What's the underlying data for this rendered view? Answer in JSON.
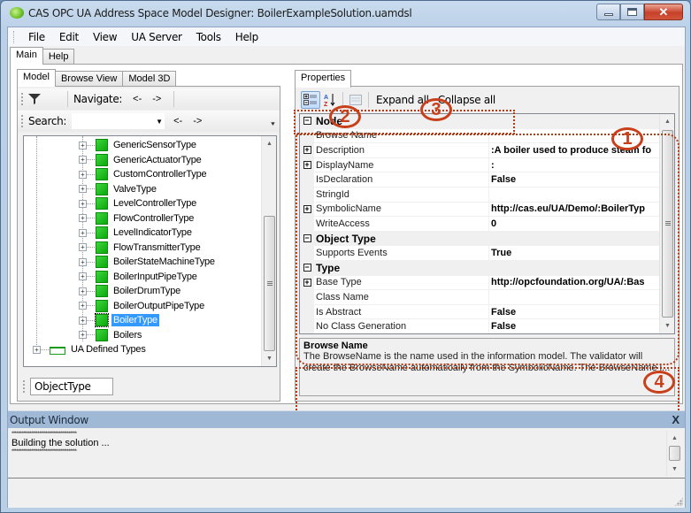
{
  "window": {
    "title": "CAS OPC UA Address Space Model Designer: BoilerExampleSolution.uamdsl",
    "icon": "app-logo-icon",
    "controls": {
      "minimize": "minimize-icon",
      "maximize": "maximize-icon",
      "close": "close-icon",
      "close_glyph": "✕"
    }
  },
  "menu": [
    "File",
    "Edit",
    "View",
    "UA Server",
    "Tools",
    "Help"
  ],
  "main_tabs": [
    {
      "label": "Main",
      "active": true
    },
    {
      "label": "Help",
      "active": false
    }
  ],
  "left_panel": {
    "tabs": [
      {
        "label": "Model",
        "active": true
      },
      {
        "label": "Browse View",
        "active": false
      },
      {
        "label": "Model 3D",
        "active": false
      }
    ],
    "toolbar": {
      "filter_icon": "filter-icon",
      "navigate_label": "Navigate:",
      "back": "<-",
      "forward": "->"
    },
    "search": {
      "label": "Search:",
      "value": "",
      "back": "<-",
      "forward": "->"
    },
    "tree": {
      "items": [
        {
          "label": "GenericSensorType",
          "level": 2,
          "selected": false
        },
        {
          "label": "GenericActuatorType",
          "level": 2,
          "selected": false
        },
        {
          "label": "CustomControllerType",
          "level": 2,
          "selected": false
        },
        {
          "label": "ValveType",
          "level": 2,
          "selected": false
        },
        {
          "label": "LevelControllerType",
          "level": 2,
          "selected": false
        },
        {
          "label": "FlowControllerType",
          "level": 2,
          "selected": false
        },
        {
          "label": "LevelIndicatorType",
          "level": 2,
          "selected": false
        },
        {
          "label": "FlowTransmitterType",
          "level": 2,
          "selected": false
        },
        {
          "label": "BoilerStateMachineType",
          "level": 2,
          "selected": false
        },
        {
          "label": "BoilerInputPipeType",
          "level": 2,
          "selected": false
        },
        {
          "label": "BoilerDrumType",
          "level": 2,
          "selected": false
        },
        {
          "label": "BoilerOutputPipeType",
          "level": 2,
          "selected": false
        },
        {
          "label": "BoilerType",
          "level": 2,
          "selected": true
        },
        {
          "label": "Boilers",
          "level": 2,
          "selected": false
        },
        {
          "label": "UA Defined Types",
          "level": 0,
          "selected": false
        }
      ]
    },
    "status_value": "ObjectType"
  },
  "properties": {
    "tab_label": "Properties",
    "toolbar": {
      "categorized": "categorized-view-icon",
      "alphabetical": "sort-az-icon",
      "pages": "property-pages-icon",
      "expand_all": "Expand all",
      "collapse_all": "Collapse all"
    },
    "rows": [
      {
        "type": "category",
        "name": "Node",
        "expanded": true
      },
      {
        "type": "prop",
        "name": "Browse Name",
        "value": "",
        "expandable": false
      },
      {
        "type": "prop",
        "name": "Description",
        "value": ":A boiler used to produce steam fo",
        "expandable": true
      },
      {
        "type": "prop",
        "name": "DisplayName",
        "value": ":",
        "expandable": true
      },
      {
        "type": "prop",
        "name": "IsDeclaration",
        "value": "False",
        "expandable": false
      },
      {
        "type": "prop",
        "name": "StringId",
        "value": "",
        "expandable": false
      },
      {
        "type": "prop",
        "name": "SymbolicName",
        "value": "http://cas.eu/UA/Demo/:BoilerTyp",
        "expandable": true
      },
      {
        "type": "prop",
        "name": "WriteAccess",
        "value": "0",
        "expandable": false
      },
      {
        "type": "category",
        "name": "Object Type",
        "expanded": true
      },
      {
        "type": "prop",
        "name": "Supports Events",
        "value": "True",
        "expandable": false
      },
      {
        "type": "category",
        "name": "Type",
        "expanded": true
      },
      {
        "type": "prop",
        "name": "Base Type",
        "value": "http://opcfoundation.org/UA/:Bas",
        "expandable": true
      },
      {
        "type": "prop",
        "name": "Class Name",
        "value": "",
        "expandable": false
      },
      {
        "type": "prop",
        "name": "Is Abstract",
        "value": "False",
        "expandable": false
      },
      {
        "type": "prop",
        "name": "No Class Generation",
        "value": "False",
        "expandable": false
      }
    ],
    "help": {
      "title": "Browse Name",
      "text": "The BrowseName is the name used in the information model. The validator will create the BrowseName automatically from the SymbolicName. The BrowseName i..."
    }
  },
  "annotations": [
    "1",
    "2",
    "3",
    "4"
  ],
  "output_window": {
    "title": "Output Window",
    "close": "X",
    "lines": [
      "****************************************",
      "Building the solution ...",
      "****************************************"
    ]
  },
  "glyphs": {
    "plus": "+",
    "minus": "−",
    "up": "▲",
    "down": "▼",
    "dropdown": "▼",
    "overflow": "⯆"
  }
}
